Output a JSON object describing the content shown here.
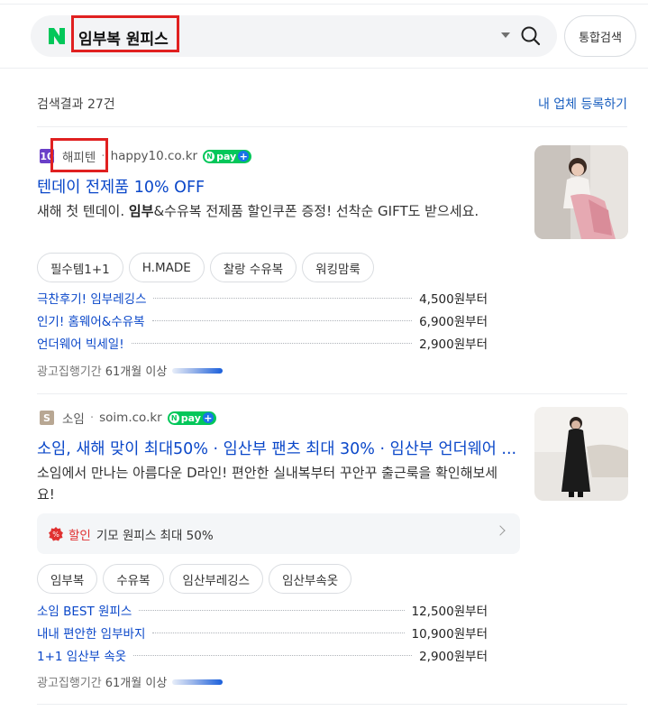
{
  "search": {
    "query": "임부복 원피스",
    "unified_button": "통합검색"
  },
  "results_header": {
    "count_label": "검색결과 27건",
    "register_link": "내 업체 등록하기"
  },
  "ads": [
    {
      "brand": "해피텐",
      "domain": "happy10.co.kr",
      "favicon_letter": "10",
      "favicon_color": "#6a3fc8",
      "pay_label": "pay",
      "title": "텐데이 전제품 10% OFF",
      "desc_pre": "새해 첫 텐데이. ",
      "desc_bold": "임부",
      "desc_post": "&수유복 전제품 할인쿠폰 증정! 선착순 GIFT도 받으세요.",
      "chips": [
        "필수템1+1",
        "H.MADE",
        "찰랑 수유복",
        "워킹맘룩"
      ],
      "prices": [
        {
          "name": "극찬후기! 임부레깅스",
          "price": "4,500원부터"
        },
        {
          "name": "인기! 홈웨어&수유복",
          "price": "6,900원부터"
        },
        {
          "name": "언더웨어 빅세일!",
          "price": "2,900원부터"
        }
      ],
      "period_label": "광고집행기간",
      "period_value": "61개월 이상",
      "thumb_desc": "pink dress model"
    },
    {
      "brand": "소임",
      "domain": "soim.co.kr",
      "favicon_letter": "S",
      "favicon_color": "#b8a793",
      "pay_label": "pay",
      "title": "소임, 새해 맞이 최대50% · 임산부 팬츠 최대 30% · 임산부 언더웨어 ...",
      "desc_pre": "소임에서 만나는 아름다운 D라인! 편안한 실내복부터 꾸안꾸 출근룩을 확인해보세요!",
      "desc_bold": "",
      "desc_post": "",
      "promo_tag": "할인",
      "promo_text": "기모 원피스 최대 50%",
      "chips": [
        "임부복",
        "수유복",
        "임산부레깅스",
        "임산부속옷"
      ],
      "prices": [
        {
          "name": "소임 BEST 원피스",
          "price": "12,500원부터"
        },
        {
          "name": "내내 편안한 임부바지",
          "price": "10,900원부터"
        },
        {
          "name": "1+1 임산부 속옷",
          "price": "2,900원부터"
        }
      ],
      "period_label": "광고집행기간",
      "period_value": "61개월 이상",
      "thumb_desc": "black dress model"
    }
  ]
}
